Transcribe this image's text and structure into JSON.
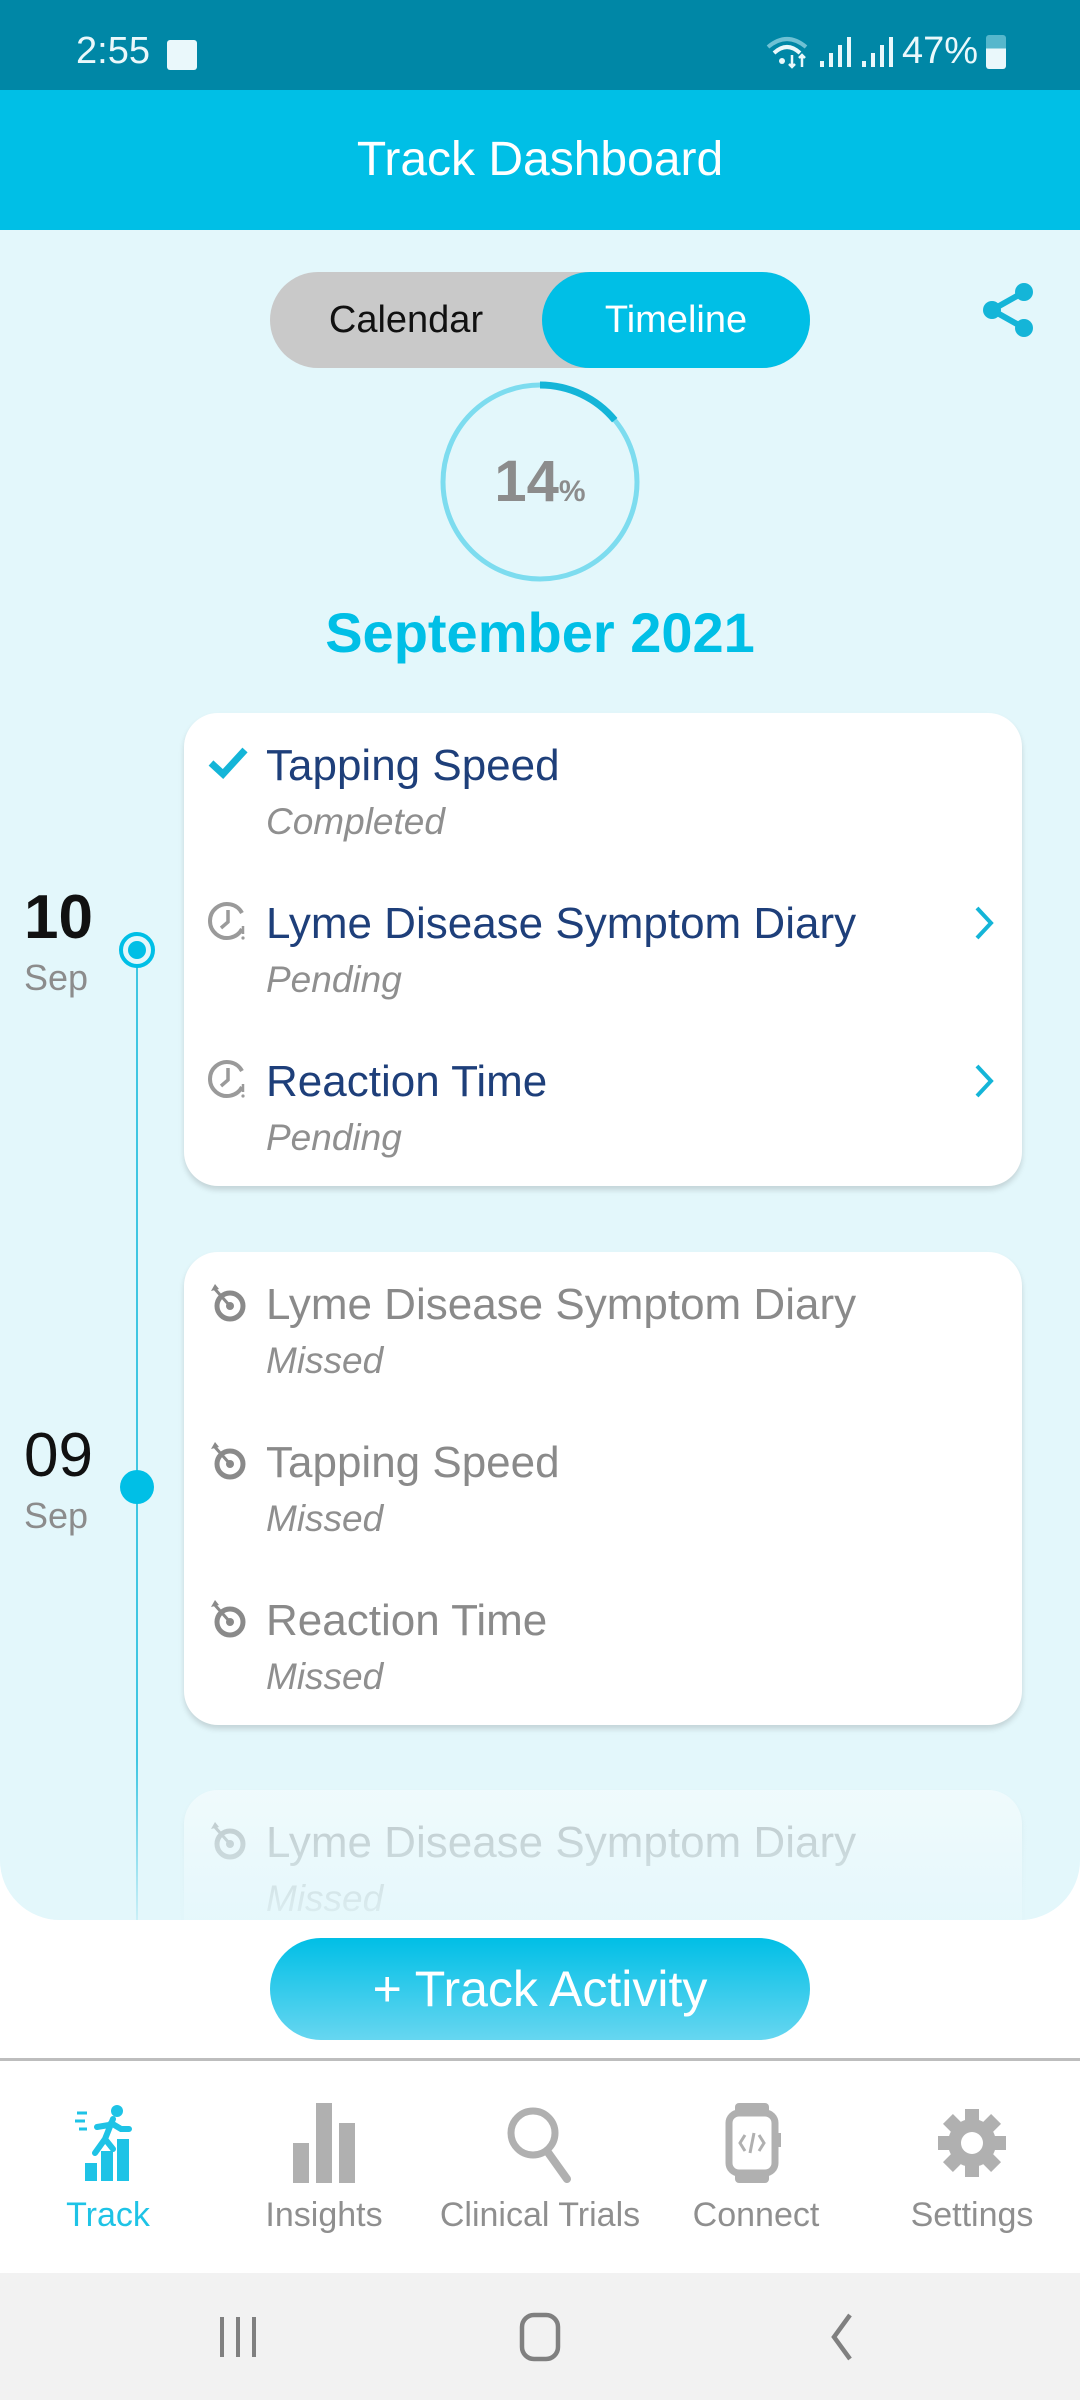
{
  "status_bar": {
    "time": "2:55",
    "battery": "47%",
    "icons": [
      "gallery-icon",
      "wifi-icon",
      "signal-icon",
      "signal-icon",
      "battery-icon"
    ]
  },
  "header": {
    "title": "Track Dashboard"
  },
  "view_toggle": {
    "options": [
      "Calendar",
      "Timeline"
    ],
    "selected": "Timeline"
  },
  "share_icon": "share-icon",
  "progress": {
    "value_text": "14",
    "unit": "%",
    "fraction": 0.14
  },
  "month_label": "September 2021",
  "timeline": [
    {
      "day": "10",
      "month": "Sep",
      "items": [
        {
          "title": "Tapping Speed",
          "status": "Completed",
          "icon": "check-icon",
          "has_chevron": false
        },
        {
          "title": "Lyme Disease Symptom Diary",
          "status": "Pending",
          "icon": "clock-pending-icon",
          "has_chevron": true
        },
        {
          "title": "Reaction Time",
          "status": "Pending",
          "icon": "clock-pending-icon",
          "has_chevron": true
        }
      ]
    },
    {
      "day": "09",
      "month": "Sep",
      "items": [
        {
          "title": "Lyme Disease Symptom Diary",
          "status": "Missed",
          "icon": "target-missed-icon",
          "has_chevron": false
        },
        {
          "title": "Tapping Speed",
          "status": "Missed",
          "icon": "target-missed-icon",
          "has_chevron": false
        },
        {
          "title": "Reaction Time",
          "status": "Missed",
          "icon": "target-missed-icon",
          "has_chevron": false
        }
      ]
    },
    {
      "items": [
        {
          "title": "Lyme Disease Symptom Diary",
          "status": "Missed",
          "icon": "target-missed-icon",
          "has_chevron": false
        }
      ]
    }
  ],
  "track_button": {
    "label": "+ Track Activity"
  },
  "bottom_nav": {
    "items": [
      {
        "label": "Track",
        "icon": "track-runner-icon",
        "active": true
      },
      {
        "label": "Insights",
        "icon": "bar-chart-icon",
        "active": false
      },
      {
        "label": "Clinical Trials",
        "icon": "search-icon",
        "active": false
      },
      {
        "label": "Connect",
        "icon": "smartwatch-icon",
        "active": false
      },
      {
        "label": "Settings",
        "icon": "gear-icon",
        "active": false
      }
    ]
  },
  "colors": {
    "accent": "#00bfe6",
    "status_bar": "#0087a6",
    "content_bg": "#e3f7fb",
    "title_active": "#1e3f7a",
    "muted": "#8f8f8f"
  }
}
